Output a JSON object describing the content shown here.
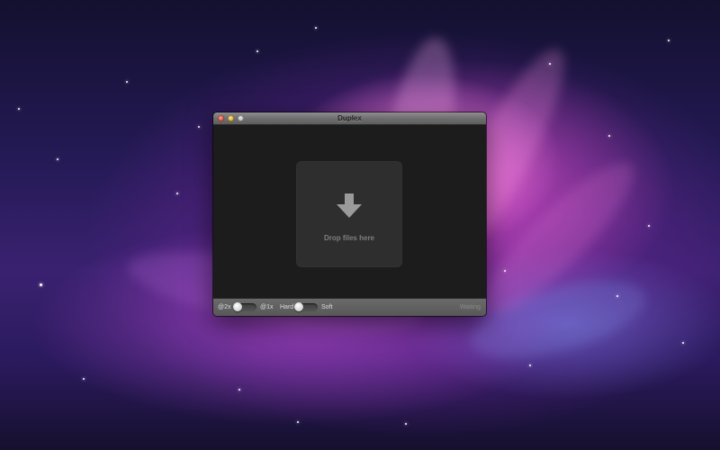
{
  "window": {
    "title": "Duplex"
  },
  "dropzone": {
    "label": "Drop files here",
    "icon": "download-arrow-icon"
  },
  "bottombar": {
    "scale_left_label": "@2x",
    "scale_right_label": "@1x",
    "scale_toggle_state": "@2x",
    "edge_left_label": "Hard",
    "edge_right_label": "Soft",
    "edge_toggle_state": "Hard",
    "status": "Waiting"
  },
  "colors": {
    "window_background": "#1c1c1c",
    "dropzone_background": "#2e2e2e",
    "titlebar": "#6f6f6f",
    "close_button": "#d23a2a",
    "minimize_button": "#d39a18",
    "zoom_button": "#9c9c9c"
  }
}
